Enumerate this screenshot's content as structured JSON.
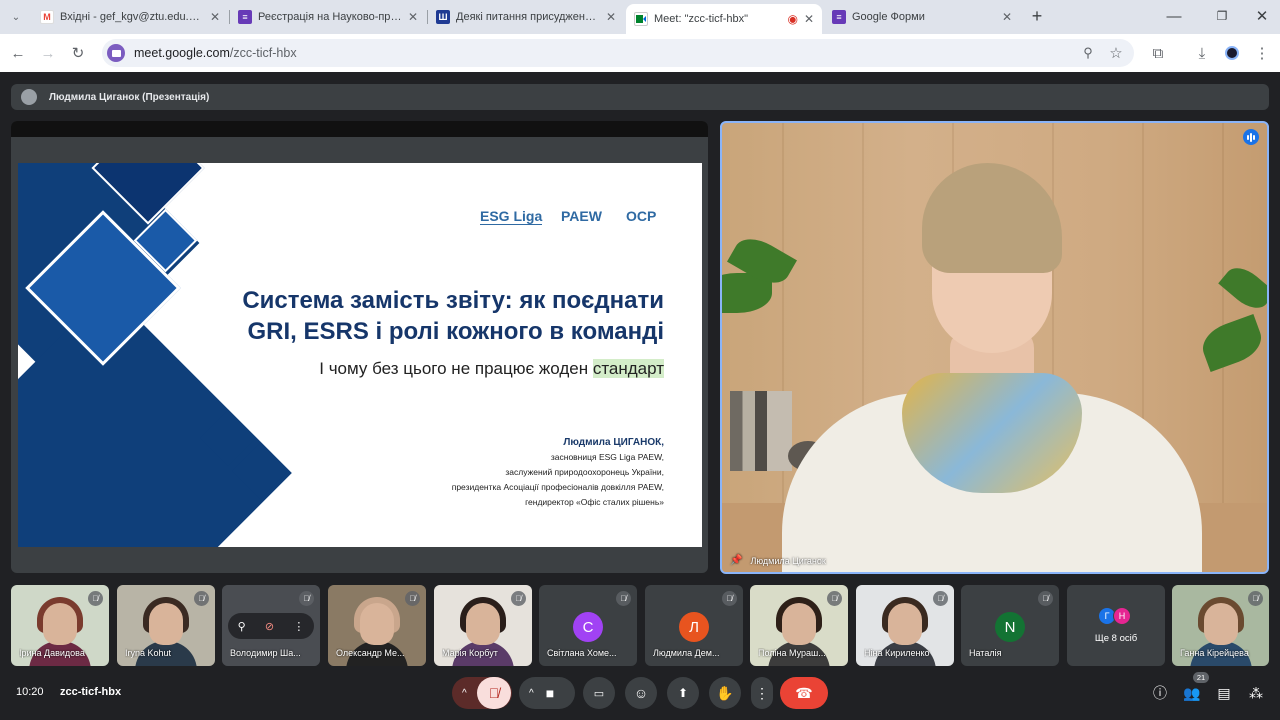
{
  "browser": {
    "tabs": [
      {
        "title": "Вхідні - gef_kgv@ztu.edu.ua - Г",
        "favicon": "gmail-icon"
      },
      {
        "title": "Реєстрація на Науково-практи",
        "favicon": "forms-icon"
      },
      {
        "title": "Деякі питання присудження (п",
        "favicon": "gov-icon"
      },
      {
        "title": "Meet: \"zcc-ticf-hbx\"",
        "favicon": "meet-icon"
      },
      {
        "title": "Google Форми",
        "favicon": "forms-icon"
      }
    ],
    "new_tab": "+",
    "url_host": "meet.google.com",
    "url_path": "/zcc-ticf-hbx"
  },
  "meeting": {
    "presenter_label": "Людмила Циганок (Презентація)",
    "speaker_name": "Людмила Циганок",
    "time": "10:20",
    "code": "zcc-ticf-hbx",
    "participants_count": "21"
  },
  "slide": {
    "logos": [
      "ESG Liga",
      "PAEW",
      "OCP"
    ],
    "title_line1": "Система замість звіту: як поєднати",
    "title_line2": "GRI, ESRS і ролі кожного в команді",
    "subtitle_pre": "І чому без цього не працює жоден ",
    "subtitle_hl": "стандарт",
    "author_name": "Людмила ЦИГАНОК,",
    "author_lines": [
      "засновниця ESG Liga PAEW,",
      "заслужений природоохоронець України,",
      "президентка Асоціації професіоналів довкілля PAEW,",
      "гендиректор «Офіс сталих рішень»"
    ]
  },
  "tiles": [
    {
      "name": "Ірина Давидова",
      "type": "photo"
    },
    {
      "name": "Iryna Kohut",
      "type": "photo"
    },
    {
      "name": "Володимир Ша...",
      "type": "photo"
    },
    {
      "name": "Олександр Ме...",
      "type": "photo"
    },
    {
      "name": "Марія Корбут",
      "type": "photo"
    },
    {
      "name": "Світлана Хоме...",
      "type": "letter",
      "letter": "С"
    },
    {
      "name": "Людмила Дем...",
      "type": "letter",
      "letter": "Л"
    },
    {
      "name": "Поліна Мураш...",
      "type": "photo"
    },
    {
      "name": "Ніна Кириленко",
      "type": "photo"
    },
    {
      "name": "Наталія",
      "type": "letter",
      "letter": "N"
    },
    {
      "name": "Ще 8 осіб",
      "type": "more",
      "letters": [
        "Г",
        "Н"
      ]
    },
    {
      "name": "Ганна Кірейцева",
      "type": "photo"
    }
  ],
  "colors": {
    "meet_bg": "#202124",
    "tile_bg": "#3c4043",
    "slide_navy": "#16366a",
    "leave_red": "#ea4335",
    "speaking_blue": "#1a73e8",
    "letter_purple": "#a142f4",
    "letter_orange": "#e8541f",
    "letter_green": "#137333"
  }
}
